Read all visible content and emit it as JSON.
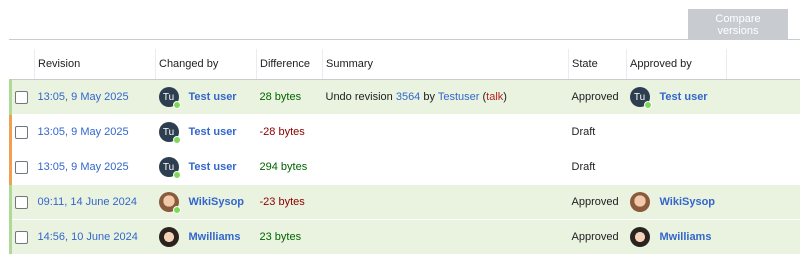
{
  "toolbar": {
    "compare_label": "Compare versions"
  },
  "table": {
    "columns": [
      "Revision",
      "Changed by",
      "Difference",
      "Summary",
      "State",
      "Approved by"
    ],
    "rows": [
      {
        "status": "approved",
        "revision": "13:05, 9 May 2025",
        "changed_by": {
          "avatar": "initials",
          "initials": "Tu",
          "name": "Test user"
        },
        "difference": "28 bytes",
        "summary": {
          "prefix": "Undo revision ",
          "revision_link": "3564",
          "by": " by ",
          "user_link": "Testuser",
          "open": " (",
          "talk": "talk",
          "close": ")"
        },
        "state": "Approved",
        "approved_by": {
          "avatar": "initials",
          "initials": "Tu",
          "name": "Test user"
        }
      },
      {
        "status": "draft",
        "revision": "13:05, 9 May 2025",
        "changed_by": {
          "avatar": "initials",
          "initials": "Tu",
          "name": "Test user"
        },
        "difference": "-28 bytes",
        "state": "Draft"
      },
      {
        "status": "draft",
        "revision": "13:05, 9 May 2025",
        "changed_by": {
          "avatar": "initials",
          "initials": "Tu",
          "name": "Test user"
        },
        "difference": "294 bytes",
        "state": "Draft"
      },
      {
        "status": "approved",
        "revision": "09:11, 14 June 2024",
        "changed_by": {
          "avatar": "photo",
          "name": "WikiSysop"
        },
        "difference": "-23 bytes",
        "state": "Approved",
        "approved_by": {
          "avatar": "photo",
          "name": "WikiSysop"
        }
      },
      {
        "status": "approved",
        "revision": "14:56, 10 June 2024",
        "changed_by": {
          "avatar": "photo",
          "name": "Mwilliams"
        },
        "difference": "23 bytes",
        "state": "Approved",
        "approved_by": {
          "avatar": "photo",
          "name": "Mwilliams"
        }
      }
    ]
  },
  "colors": {
    "link": "#3366cc",
    "approved_row_bg": "#eaf3e0",
    "approved_stripe": "#b0d897",
    "draft_stripe": "#f0a050",
    "positive_diff": "#006400",
    "negative_diff": "#8b0000"
  }
}
